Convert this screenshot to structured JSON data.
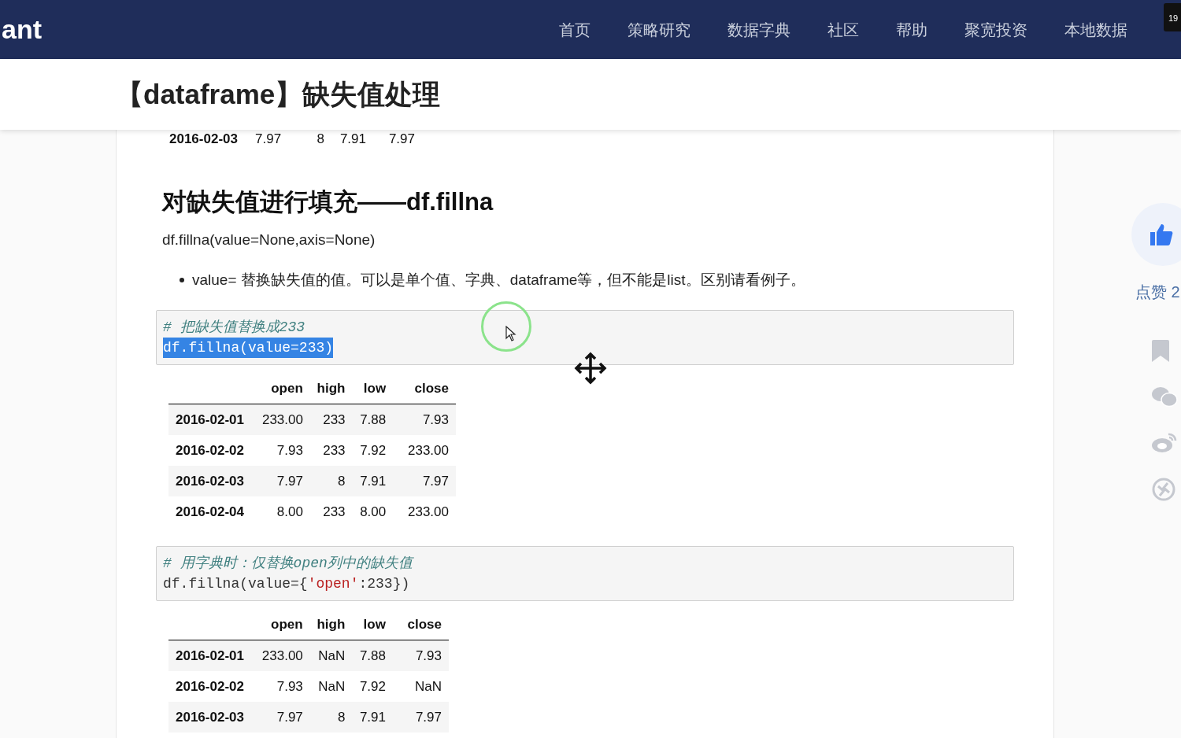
{
  "header": {
    "logo": "ant",
    "nav": [
      "首页",
      "策略研究",
      "数据字典",
      "社区",
      "帮助",
      "聚宽投资",
      "本地数据"
    ],
    "badge": "19"
  },
  "title": "【dataframe】缺失值处理",
  "partial_row": [
    "2016-02-03",
    "7.97",
    "8",
    "7.91",
    "7.97"
  ],
  "section": {
    "heading": "对缺失值进行填充——df.fillna",
    "signature": "df.fillna(value=None,axis=None)",
    "bullets": [
      "value= 替换缺失值的值。可以是单个值、字典、dataframe等，但不能是list。区别请看例子。"
    ]
  },
  "examples": [
    {
      "code": [
        {
          "kind": "comment",
          "selected": false,
          "parts": [
            {
              "kind": "plain",
              "text": "# 把缺失值替换成233"
            }
          ]
        },
        {
          "kind": "code",
          "selected": true,
          "parts": [
            {
              "kind": "plain",
              "text": "df.fillna(value=233)"
            }
          ]
        }
      ],
      "table": {
        "columns": [
          "open",
          "high",
          "low",
          "close"
        ],
        "rows": [
          {
            "index": "2016-02-01",
            "cells": [
              "233.00",
              "233",
              "7.88",
              "7.93"
            ]
          },
          {
            "index": "2016-02-02",
            "cells": [
              "7.93",
              "233",
              "7.92",
              "233.00"
            ]
          },
          {
            "index": "2016-02-03",
            "cells": [
              "7.97",
              "8",
              "7.91",
              "7.97"
            ]
          },
          {
            "index": "2016-02-04",
            "cells": [
              "8.00",
              "233",
              "8.00",
              "233.00"
            ]
          }
        ]
      }
    },
    {
      "code": [
        {
          "kind": "comment",
          "selected": false,
          "parts": [
            {
              "kind": "plain",
              "text": "# 用字典时：仅替换open列中的缺失值"
            }
          ]
        },
        {
          "kind": "code",
          "selected": false,
          "parts": [
            {
              "kind": "plain",
              "text": "df.fillna(value={"
            },
            {
              "kind": "string",
              "text": "'open'"
            },
            {
              "kind": "plain",
              "text": ":233})"
            }
          ]
        }
      ],
      "table": {
        "columns": [
          "open",
          "high",
          "low",
          "close"
        ],
        "rows": [
          {
            "index": "2016-02-01",
            "cells": [
              "233.00",
              "NaN",
              "7.88",
              "7.93"
            ]
          },
          {
            "index": "2016-02-02",
            "cells": [
              "7.93",
              "NaN",
              "7.92",
              "NaN"
            ]
          },
          {
            "index": "2016-02-03",
            "cells": [
              "7.97",
              "8",
              "7.91",
              "7.97"
            ]
          }
        ]
      }
    }
  ],
  "side": {
    "like_label": "点赞 2"
  }
}
